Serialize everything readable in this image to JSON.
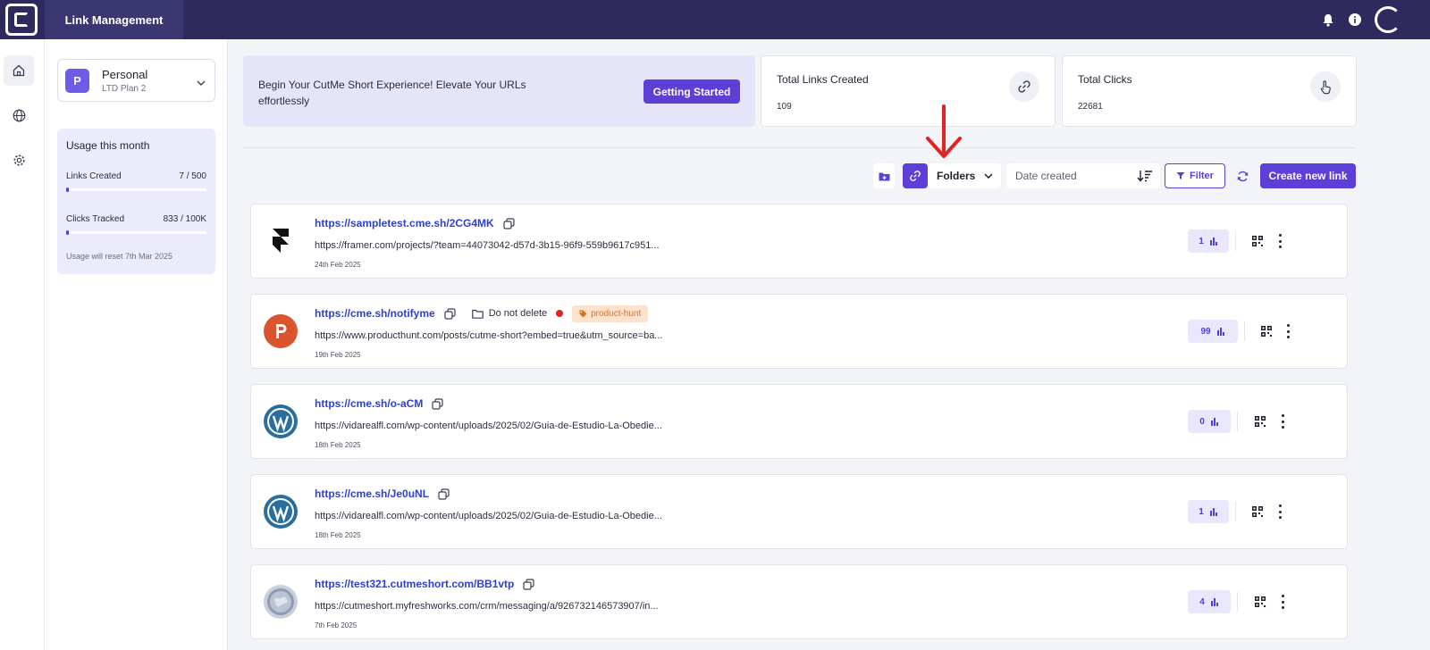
{
  "header": {
    "app_tab": "Link Management"
  },
  "workspace": {
    "badge": "P",
    "name": "Personal",
    "plan": "LTD Plan 2"
  },
  "usage": {
    "title": "Usage this month",
    "links_label": "Links Created",
    "links_value": "7 / 500",
    "links_fraction": 0.014,
    "clicks_label": "Clicks Tracked",
    "clicks_value": "833 / 100K",
    "clicks_fraction": 0.008,
    "reset_note": "Usage will reset 7th Mar 2025"
  },
  "banner": {
    "text": "Begin Your CutMe Short Experience! Elevate Your URLs effortlessly",
    "button": "Getting Started"
  },
  "stats": {
    "total_links_label": "Total Links Created",
    "total_links_value": "109",
    "total_clicks_label": "Total Clicks",
    "total_clicks_value": "22681"
  },
  "toolbar": {
    "folders_label": "Folders",
    "sort_label": "Date created",
    "filter_label": "Filter",
    "create_label": "Create new link"
  },
  "links": [
    {
      "short": "https://sampletest.cme.sh/2CG4MK",
      "dest": "https://framer.com/projects/?team=44073042-d57d-3b15-96f9-559b9617c951...",
      "date": "24th Feb 2025",
      "clicks": "1",
      "favicon": "framer-icon"
    },
    {
      "short": "https://cme.sh/notifyme",
      "dest": "https://www.producthunt.com/posts/cutme-short?embed=true&utm_source=ba...",
      "date": "19th Feb 2025",
      "clicks": "99",
      "favicon": "producthunt-icon",
      "folder": "Do not delete",
      "tag": "product-hunt"
    },
    {
      "short": "https://cme.sh/o-aCM",
      "dest": "https://vidarealfl.com/wp-content/uploads/2025/02/Guia-de-Estudio-La-Obedie...",
      "date": "18th Feb 2025",
      "clicks": "0",
      "favicon": "wordpress-icon"
    },
    {
      "short": "https://cme.sh/Je0uNL",
      "dest": "https://vidarealfl.com/wp-content/uploads/2025/02/Guia-de-Estudio-La-Obedie...",
      "date": "18th Feb 2025",
      "clicks": "1",
      "favicon": "wordpress-icon"
    },
    {
      "short": "https://test321.cutmeshort.com/BB1vtp",
      "dest": "https://cutmeshort.myfreshworks.com/crm/messaging/a/926732146573907/in...",
      "date": "7th Feb 2025",
      "clicks": "4",
      "favicon": "globe-icon"
    }
  ],
  "colors": {
    "header_bg": "#2e2a5e",
    "accent": "#5b3fd6",
    "link_blue": "#2d3fd6",
    "annotation_red": "#e02424"
  }
}
